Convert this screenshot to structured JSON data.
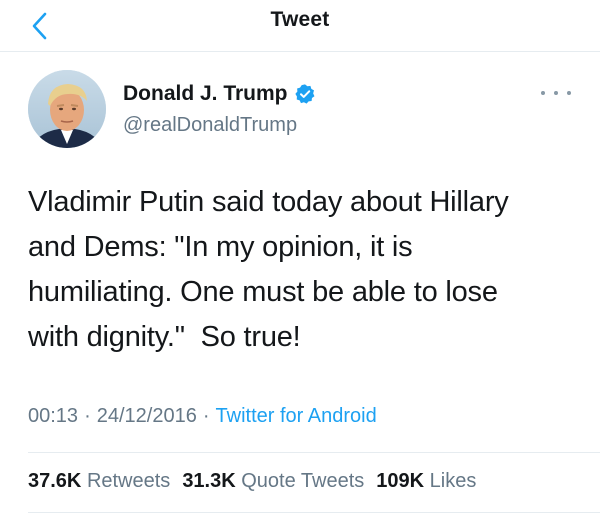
{
  "header": {
    "title": "Tweet",
    "back_icon": "chevron-left-icon"
  },
  "author": {
    "name": "Donald J. Trump",
    "handle": "@realDonaldTrump",
    "verified": true
  },
  "tweet": {
    "text": "Vladimir Putin said today about Hillary\nand Dems: \"In my opinion, it is\nhumiliating. One must be able to lose\nwith dignity.\"  So true!",
    "time": "00:13",
    "date": "24/12/2016",
    "source": "Twitter for Android"
  },
  "stats": {
    "retweets_count": "37.6K",
    "retweets_label": "Retweets",
    "quotes_count": "31.3K",
    "quotes_label": "Quote Tweets",
    "likes_count": "109K",
    "likes_label": "Likes"
  },
  "colors": {
    "accent": "#1da1f2",
    "secondary_text": "#657786",
    "divider": "#e6ecf0"
  }
}
